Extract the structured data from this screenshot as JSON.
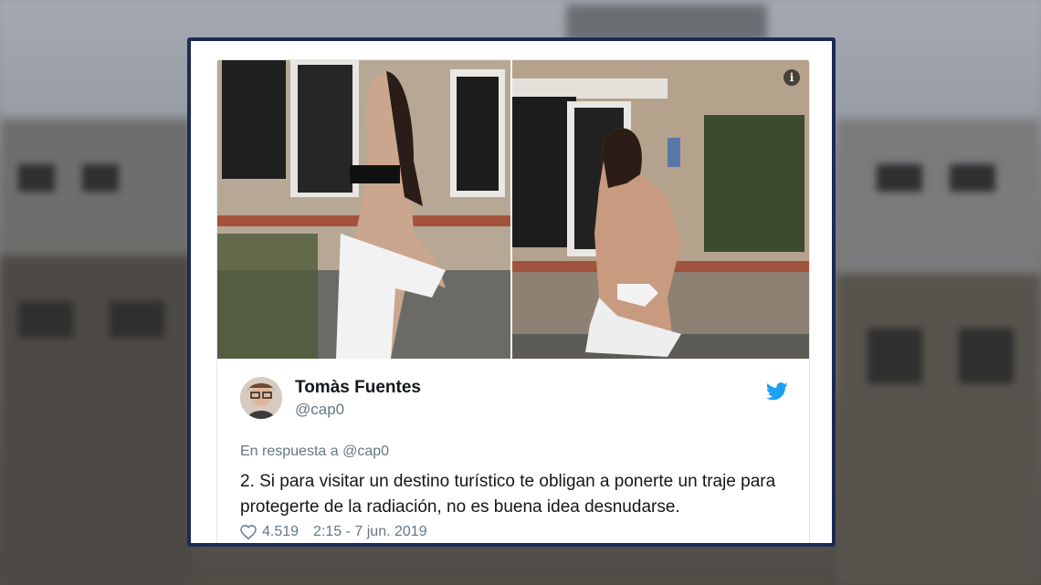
{
  "tweet": {
    "author_name": "Tomàs Fuentes",
    "author_handle": "@cap0",
    "reply_prefix": "En respuesta a",
    "reply_handle": "@cap0",
    "text": "2. Si para visitar un destino turístico te obligan a ponerte un traje para protegerte de la radiación, no es buena idea desnudarse.",
    "likes": "4.519",
    "timestamp": "2:15 - 7 jun. 2019"
  },
  "icons": {
    "info": "i",
    "bird": "twitter-bird-icon",
    "heart": "heart-outline-icon"
  },
  "colors": {
    "card_border": "#1d2a57",
    "twitter_blue": "#1da1f2",
    "secondary_text": "#657786"
  }
}
